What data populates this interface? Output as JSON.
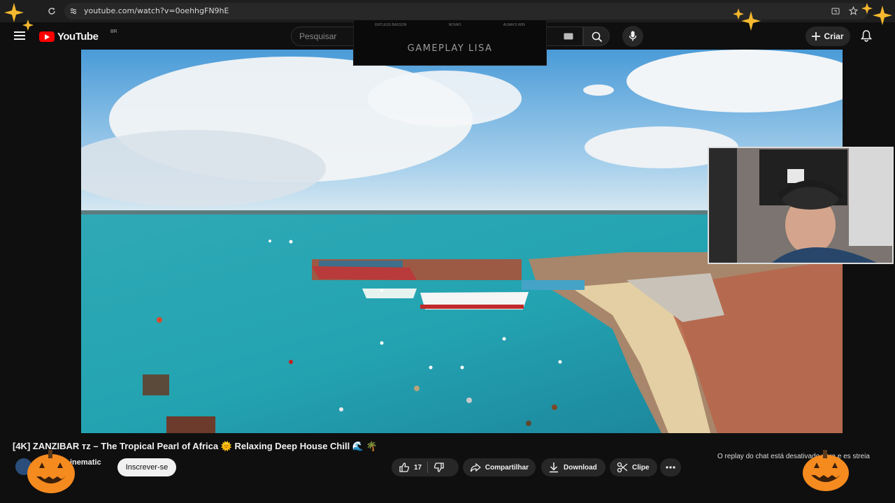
{
  "browser": {
    "url": "youtube.com/watch?v=0oehhgFN9hE"
  },
  "header": {
    "logo_text": "YouTube",
    "country_code": "BR",
    "search_placeholder": "Pesquisar",
    "create_label": "Criar"
  },
  "overlay": {
    "top_items": [
      "ENTLESS BASSON",
      "NOVAO",
      "ALWAYS WIN"
    ],
    "title": "GAMEPLAY LISA"
  },
  "video_info": {
    "title": "[4K] ZANZIBAR ᴛᴢ – The Tropical Pearl of Africa 🌞 Relaxing Deep House Chill 🌊 🌴",
    "channel_name": "inematic",
    "subscribers": "s",
    "subscribe_label": "Inscrever-se"
  },
  "actions": {
    "likes": "17",
    "share_label": "Compartilhar",
    "download_label": "Download",
    "clip_label": "Clipe"
  },
  "chat": {
    "replay_note": "O replay do chat está desativado para e   es   streia"
  },
  "colors": {
    "brand_red": "#ff0000",
    "background": "#0f0f0f",
    "pill": "#272727"
  },
  "icons": [
    "menu-icon",
    "search-icon",
    "mic-icon",
    "plus-icon",
    "bell-icon",
    "like-icon",
    "dislike-icon",
    "share-icon",
    "download-icon",
    "scissors-icon",
    "more-icon"
  ]
}
